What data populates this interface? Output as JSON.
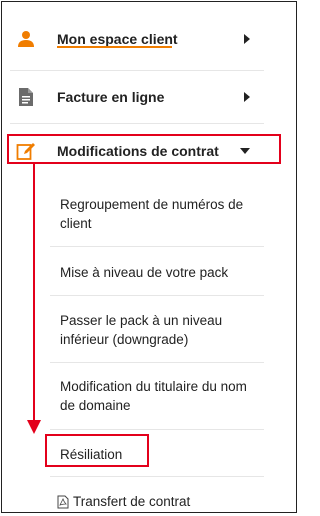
{
  "menu": {
    "items": [
      {
        "label": "Mon espace client",
        "icon": "user-icon",
        "arrow": "chevron-right"
      },
      {
        "label": "Facture en ligne",
        "icon": "document-icon",
        "arrow": "chevron-right"
      },
      {
        "label": "Modifications de contrat",
        "icon": "edit-icon",
        "arrow": "chevron-down"
      }
    ],
    "subitems": [
      "Regroupement de numéros de client",
      "Mise à niveau de votre pack",
      "Passer le pack à un niveau inférieur (downgrade)",
      "Modification du titulaire du nom de domaine",
      "Résiliation",
      "Transfert de contrat"
    ]
  },
  "colors": {
    "accent": "#f07d00",
    "highlight": "#e3001b",
    "icon_grey": "#6b6b6b"
  }
}
